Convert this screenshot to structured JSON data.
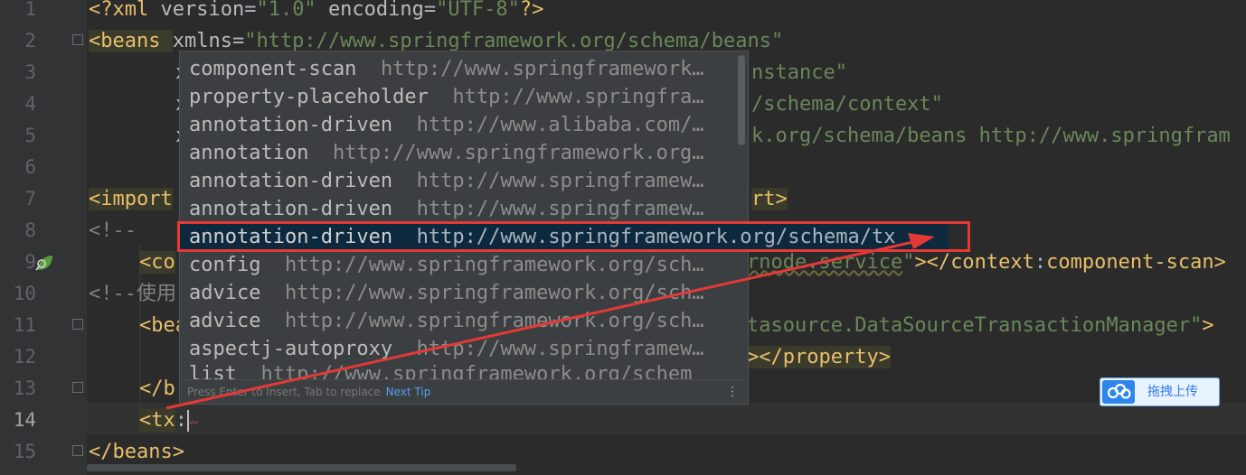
{
  "gutter": {
    "line_numbers": [
      "1",
      "2",
      "3",
      "4",
      "5",
      "6",
      "7",
      "8",
      "9",
      "10",
      "11",
      "12",
      "13",
      "14",
      "15"
    ]
  },
  "code": {
    "line1": {
      "open": "<?xml ",
      "a1": "version",
      "eq1": "=",
      "v1": "\"1.0\"",
      "sp": " ",
      "a2": "encoding",
      "eq2": "=",
      "v2": "\"UTF-8\"",
      "close": "?>"
    },
    "line2": {
      "open": "<beans ",
      "a1": "xmlns",
      "eq1": "=",
      "v1": "\"http://www.springframework.org/schema/beans\""
    },
    "line3": {
      "prefix": "x",
      "tail": "nstance\""
    },
    "line4": {
      "prefix": "x",
      "tail": "/schema/context\""
    },
    "line5": {
      "prefix": "x",
      "tail": "k.org/schema/beans http://www.springfram"
    },
    "line7": {
      "open": "<import",
      "tail": "rt>"
    },
    "line8": {
      "text": "<!--"
    },
    "line9": {
      "open": "<co",
      "str": "rnode.service",
      "quote": "\"",
      "close": "></",
      "close_tag": "context",
      "colon": ":",
      "name": "component-scan",
      "gt": ">"
    },
    "line10": {
      "text": "<!--使用"
    },
    "line11": {
      "open": "<bea",
      "tail": "tasource.DataSourceTransactionManager\"",
      "gt": ">"
    },
    "line12": {
      "tail": "></property>"
    },
    "line13": {
      "text": "</b"
    },
    "line14": {
      "open": "<tx",
      "colon": ":"
    },
    "line15": {
      "text": "</beans>"
    }
  },
  "popup": {
    "items": [
      {
        "name": "component-scan",
        "url": "http://www.springframework…"
      },
      {
        "name": "property-placeholder",
        "url": "http://www.springfra…"
      },
      {
        "name": "annotation-driven",
        "url": "http://www.alibaba.com/…"
      },
      {
        "name": "annotation",
        "url": "http://www.springframework.org…"
      },
      {
        "name": "annotation-driven",
        "url": "http://www.springframew…"
      },
      {
        "name": "annotation-driven",
        "url": "http://www.springframew…"
      },
      {
        "name": "annotation-driven",
        "url": "http://www.springframework.org/schema/tx"
      },
      {
        "name": "config",
        "url": "http://www.springframework.org/sch…"
      },
      {
        "name": "advice",
        "url": "http://www.springframework.org/sch…"
      },
      {
        "name": "advice",
        "url": "http://www.springframework.org/sch…"
      },
      {
        "name": "aspectj-autoproxy",
        "url": "http://www.springframew…"
      },
      {
        "name": "list",
        "url": "http://www.springframework.org/schem"
      }
    ],
    "selected_index": 6,
    "footer_hint": "Press Enter to Insert, Tab to replace",
    "footer_link": "Next Tip",
    "more_icon": "⋮"
  },
  "upload_button": {
    "label": "拖拽上传"
  },
  "colors": {
    "background": "#2b2b2b",
    "tag": "#e8bf6a",
    "string": "#6a8759",
    "annotation_box": "#e53935"
  }
}
